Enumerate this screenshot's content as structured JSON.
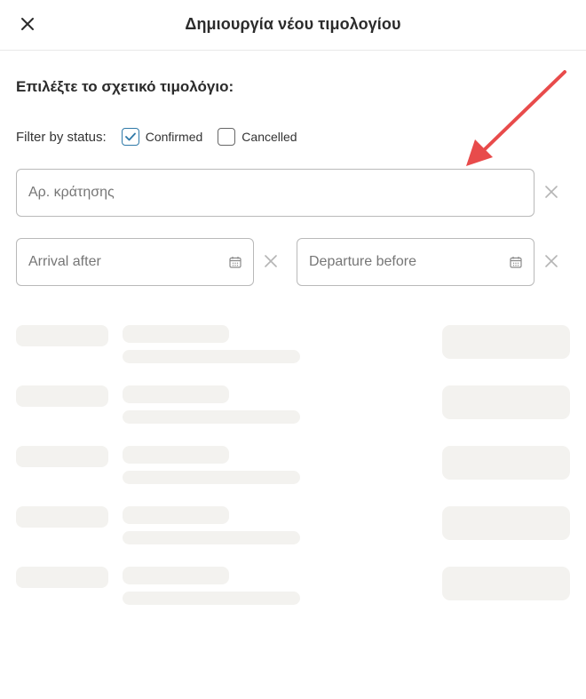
{
  "header": {
    "title": "Δημιουργία νέου τιμολογίου",
    "close_icon": "close-icon"
  },
  "section": {
    "heading": "Επιλέξτε το σχετικό τιμολόγιο:"
  },
  "filter": {
    "label": "Filter by status:",
    "options": [
      {
        "label": "Confirmed",
        "checked": true
      },
      {
        "label": "Cancelled",
        "checked": false
      }
    ]
  },
  "inputs": {
    "booking_number": {
      "placeholder": "Αρ. κράτησης",
      "value": ""
    },
    "arrival_after": {
      "placeholder": "Arrival after",
      "value": "",
      "icon": "calendar-icon"
    },
    "departure_before": {
      "placeholder": "Departure before",
      "value": "",
      "icon": "calendar-icon"
    }
  },
  "loading_rows": 5,
  "colors": {
    "accent": "#2f79a8",
    "skeleton": "#f3f2ef",
    "annotation_arrow": "#e84b4b",
    "border": "#b9b9b9",
    "placeholder": "#767676"
  }
}
